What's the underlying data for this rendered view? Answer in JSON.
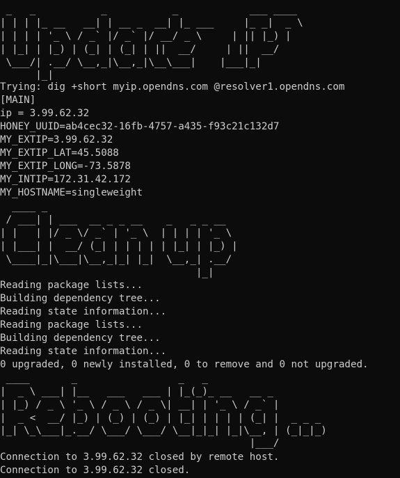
{
  "terminal": {
    "background": "#0c0c0c",
    "foreground": "#cccccc",
    "lines": [
      " _   _           _           _            ___ ____",
      "| | | |_ __   __| | __ _  __| |_ ___     |_ _|  _ \\",
      "| | | | '_ \\ / _` |/ _` |/ __/ _ \\     | || |_) |",
      "| |_| | |_) | (_| | (_| | ||  __/     | ||  __/",
      " \\___/| .__/ \\__,_|\\__,_|\\__\\___|    |___|_|",
      "      |_|",
      "Trying: dig +short myip.opendns.com @resolver1.opendns.com",
      "[MAIN]",
      "ip = 3.99.62.32",
      "HONEY_UUID=ab4cec32-16fb-4757-a435-f93c21c132d7",
      "MY_EXTIP=3.99.62.32",
      "MY_EXTIP_LAT=45.5088",
      "MY_EXTIP_LONG=-73.5878",
      "MY_INTIP=172.31.42.172",
      "MY_HOSTNAME=singleweight",
      "  ____ _",
      " / ___| | ___  __ _ _ __    _   _ _ __",
      "| |   | |/ _ \\/ _` | '_ \\  | | | | '_ \\",
      "| |___| |  __/ (_| | | | | | |_| | |_) |",
      " \\____|_|\\___|\\__,_|_| |_|  \\__,_| .__/",
      "                                 |_|",
      "Reading package lists...",
      "Building dependency tree...",
      "Reading state information...",
      "Reading package lists...",
      "Building dependency tree...",
      "Reading state information...",
      "0 upgraded, 0 newly installed, 0 to remove and 0 not upgraded.",
      " ____       _                 _   _",
      "|  _ \\ ___| |__   ___   ___ | |_(_)_ __   __ _",
      "| |_) / _ \\ '_ \\ / _ \\ / _ \\| __| | '_ \\ / _` |",
      "|  _ <  __/ |_) | (_) | (_) | |_| | | | | (_| |  _ _ _",
      "|_| \\_\\___|_.__/ \\___/ \\___/ \\__|_|_| |_|\\__, | (_|_|_)",
      "                                          |___/",
      "Connection to 3.99.62.32 closed by remote host.",
      "Connection to 3.99.62.32 closed."
    ]
  }
}
